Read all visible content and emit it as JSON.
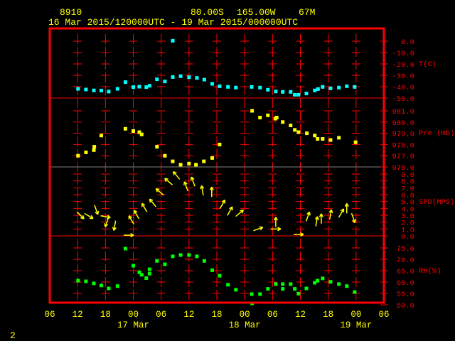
{
  "header": {
    "station": "8910",
    "lat": "80.00S",
    "lon": "165.00W",
    "elev": "67M",
    "period": "16 Mar 2015/120000UTC - 19 Mar 2015/000000UTC"
  },
  "page_number": "2",
  "colors": {
    "frame": "#ff0000",
    "text": "#ffff00",
    "temp": "#00ffff",
    "pres": "#ffff00",
    "wind": "#ffff00",
    "rh": "#00ff00",
    "grid_gray": "#808080"
  },
  "x_axis": {
    "tick_labels": [
      "06",
      "12",
      "18",
      "00",
      "06",
      "12",
      "18",
      "00",
      "06",
      "12",
      "18",
      "00",
      "06"
    ],
    "date_labels": [
      {
        "label": "17 Mar",
        "hour": 18
      },
      {
        "label": "18 Mar",
        "hour": 42
      },
      {
        "label": "19 Mar",
        "hour": 66
      }
    ],
    "range_hours_from_16Mar06": [
      0,
      72
    ]
  },
  "chart_data": [
    {
      "type": "scatter",
      "name": "temperature",
      "ylabel": "T(C)",
      "ylim": [
        -50,
        0
      ],
      "tick_labels": [
        "0.0",
        "-10.0",
        "-20.0",
        "-30.0",
        "-40.0",
        "-50.0"
      ],
      "x_unit": "hours since 16 Mar 06UTC",
      "points": [
        [
          6.1,
          -41.9
        ],
        [
          7.8,
          -42.5
        ],
        [
          9.5,
          -43.3
        ],
        [
          11.1,
          -43.4
        ],
        [
          12.7,
          -44.3
        ],
        [
          14.6,
          -41.9
        ],
        [
          16.3,
          -36.0
        ],
        [
          18.0,
          -40.4
        ],
        [
          19.3,
          -40.0
        ],
        [
          20.8,
          -40.4
        ],
        [
          21.5,
          -39.2
        ],
        [
          23.1,
          -33.5
        ],
        [
          24.8,
          -35.4
        ],
        [
          26.5,
          0.4
        ],
        [
          26.5,
          -31.5
        ],
        [
          28.2,
          -30.8
        ],
        [
          30.0,
          -31.7
        ],
        [
          31.7,
          -32.3
        ],
        [
          33.3,
          -33.8
        ],
        [
          35.0,
          -37.5
        ],
        [
          36.6,
          -39.6
        ],
        [
          38.4,
          -40.2
        ],
        [
          40.1,
          -40.8
        ],
        [
          43.5,
          -40.2
        ],
        [
          45.3,
          -40.8
        ],
        [
          47.0,
          -42.7
        ],
        [
          48.7,
          -44.2
        ],
        [
          50.2,
          -44.6
        ],
        [
          51.9,
          -44.6
        ],
        [
          52.8,
          -47.1
        ],
        [
          53.6,
          -47.1
        ],
        [
          55.3,
          -46.0
        ],
        [
          57.1,
          -43.3
        ],
        [
          57.8,
          -42.1
        ],
        [
          58.8,
          -40.2
        ],
        [
          60.5,
          -41.5
        ],
        [
          62.3,
          -40.8
        ],
        [
          64.0,
          -39.6
        ],
        [
          65.7,
          -40.2
        ]
      ]
    },
    {
      "type": "scatter",
      "name": "pressure",
      "ylabel": "Pre (mb)",
      "ylim": [
        976,
        981
      ],
      "tick_labels": [
        "981.0",
        "980.0",
        "979.0",
        "978.0",
        "977.0",
        "976.0"
      ],
      "points": [
        [
          6.1,
          977.0
        ],
        [
          7.8,
          977.3
        ],
        [
          9.5,
          977.5
        ],
        [
          9.6,
          977.8
        ],
        [
          11.1,
          978.8
        ],
        [
          16.3,
          979.4
        ],
        [
          18.0,
          979.2
        ],
        [
          19.3,
          979.1
        ],
        [
          19.8,
          978.9
        ],
        [
          23.1,
          977.8
        ],
        [
          24.8,
          977.0
        ],
        [
          26.5,
          976.5
        ],
        [
          28.2,
          976.2
        ],
        [
          30.0,
          976.3
        ],
        [
          31.5,
          976.2
        ],
        [
          33.2,
          976.5
        ],
        [
          35.0,
          976.8
        ],
        [
          36.6,
          978.0
        ],
        [
          43.6,
          981.0
        ],
        [
          45.3,
          980.4
        ],
        [
          47.0,
          980.6
        ],
        [
          48.6,
          980.3
        ],
        [
          48.9,
          980.4
        ],
        [
          50.2,
          980.0
        ],
        [
          51.9,
          979.7
        ],
        [
          52.8,
          979.3
        ],
        [
          53.6,
          979.1
        ],
        [
          55.4,
          979.0
        ],
        [
          57.1,
          978.8
        ],
        [
          57.7,
          978.5
        ],
        [
          58.8,
          978.5
        ],
        [
          60.5,
          978.4
        ],
        [
          62.3,
          978.6
        ],
        [
          65.9,
          978.2
        ]
      ]
    },
    {
      "type": "vector",
      "name": "wind",
      "ylabel": "SPD(MPS)",
      "ylim": [
        0,
        10
      ],
      "tick_labels": [
        "9.0",
        "8.0",
        "7.0",
        "6.0",
        "5.0",
        "4.0",
        "3.0",
        "2.0",
        "1.0",
        "0.0"
      ],
      "vectors_hour_speed_toward_deg": [
        [
          6.6,
          3.0,
          135
        ],
        [
          8.4,
          2.9,
          120
        ],
        [
          10.0,
          3.8,
          160
        ],
        [
          12.0,
          2.8,
          100
        ],
        [
          12.3,
          2.0,
          200
        ],
        [
          14.0,
          1.5,
          190
        ],
        [
          17.0,
          0.1,
          90
        ],
        [
          17.6,
          2.3,
          330
        ],
        [
          18.7,
          3.1,
          330
        ],
        [
          20.4,
          4.1,
          330
        ],
        [
          22.2,
          4.8,
          320
        ],
        [
          23.7,
          6.4,
          310
        ],
        [
          25.6,
          7.9,
          310
        ],
        [
          27.3,
          8.8,
          320
        ],
        [
          29.4,
          7.2,
          340
        ],
        [
          30.9,
          7.9,
          340
        ],
        [
          32.9,
          6.6,
          350
        ],
        [
          34.9,
          6.4,
          0
        ],
        [
          37.2,
          4.6,
          30
        ],
        [
          38.8,
          3.6,
          30
        ],
        [
          40.9,
          3.3,
          50
        ],
        [
          44.9,
          1.0,
          70
        ],
        [
          48.7,
          1.0,
          90
        ],
        [
          48.7,
          2.0,
          0
        ],
        [
          53.6,
          0.2,
          90
        ],
        [
          55.6,
          2.8,
          20
        ],
        [
          57.5,
          2.1,
          10
        ],
        [
          58.5,
          2.5,
          0
        ],
        [
          60.5,
          3.1,
          10
        ],
        [
          62.8,
          3.3,
          30
        ],
        [
          64.0,
          4.0,
          0
        ],
        [
          65.4,
          2.6,
          160
        ]
      ]
    },
    {
      "type": "scatter",
      "name": "relative_humidity",
      "ylabel": "RH(%)",
      "ylim": [
        50,
        75
      ],
      "tick_labels": [
        "75.0",
        "70.0",
        "65.0",
        "60.0",
        "55.0",
        "50.0"
      ],
      "points": [
        [
          6.1,
          60.6
        ],
        [
          7.8,
          60.3
        ],
        [
          9.5,
          59.4
        ],
        [
          11.1,
          58.5
        ],
        [
          12.7,
          57.2
        ],
        [
          14.6,
          58.2
        ],
        [
          16.3,
          74.7
        ],
        [
          18.0,
          67.2
        ],
        [
          19.3,
          64.3
        ],
        [
          19.8,
          63.2
        ],
        [
          20.8,
          61.7
        ],
        [
          21.5,
          63.7
        ],
        [
          21.5,
          65.6
        ],
        [
          23.1,
          69.3
        ],
        [
          24.8,
          67.8
        ],
        [
          26.5,
          71.3
        ],
        [
          28.2,
          71.9
        ],
        [
          30.0,
          71.9
        ],
        [
          31.7,
          71.3
        ],
        [
          33.3,
          69.3
        ],
        [
          35.0,
          65.2
        ],
        [
          36.6,
          62.8
        ],
        [
          38.4,
          58.8
        ],
        [
          40.1,
          56.6
        ],
        [
          43.5,
          54.7
        ],
        [
          43.6,
          50.6
        ],
        [
          45.3,
          54.7
        ],
        [
          47.0,
          57.0
        ],
        [
          48.7,
          59.1
        ],
        [
          50.2,
          59.1
        ],
        [
          50.2,
          57.0
        ],
        [
          51.9,
          59.1
        ],
        [
          52.8,
          57.0
        ],
        [
          53.6,
          54.9
        ],
        [
          55.3,
          57.2
        ],
        [
          57.1,
          59.7
        ],
        [
          57.7,
          60.6
        ],
        [
          58.8,
          61.6
        ],
        [
          60.5,
          60.1
        ],
        [
          62.3,
          59.1
        ],
        [
          64.0,
          58.2
        ],
        [
          65.7,
          55.6
        ]
      ]
    }
  ]
}
